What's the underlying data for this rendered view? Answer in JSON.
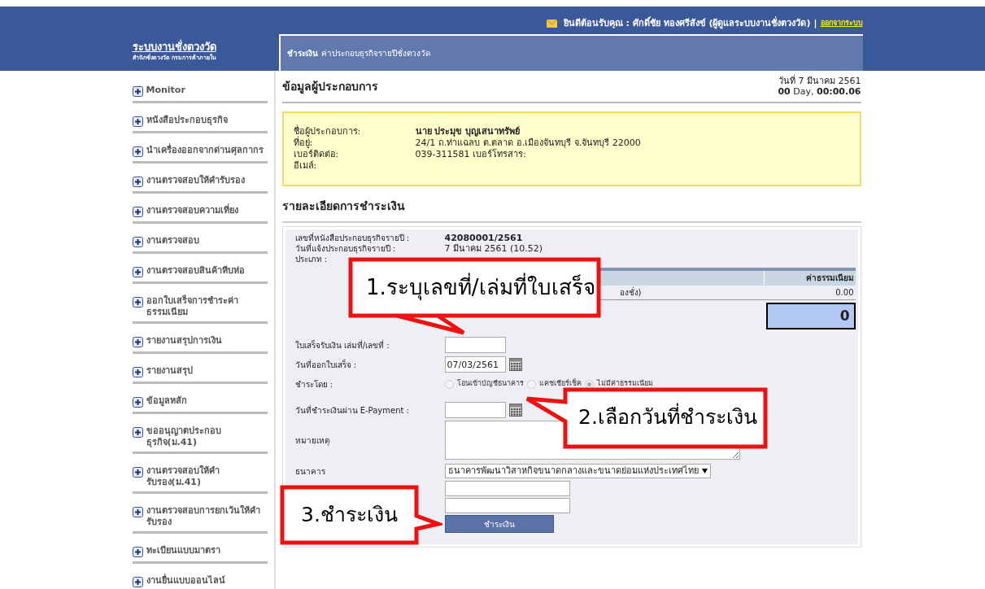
{
  "header": {
    "welcome": "ยินดีต้อนรับคุณ : ศักดิ์ชัย ทองศรีสังข์ (ผู้ดูแลระบบงานชั่งตวงวัด)",
    "separator": "|",
    "logout": "ออกจากระบบ"
  },
  "logo": {
    "title": "ระบบงานชั่งตวงวัด",
    "subtitle": "สำนักชั่งตวงวัด กรมการค้าภายใน"
  },
  "breadcrumb": {
    "section": "ชำระเงิน",
    "page": "ค่าประกอบธุรกิจรายปีชั่งตวงวัด"
  },
  "sidebar": {
    "items": [
      {
        "label": "Monitor"
      },
      {
        "label": "หนังสือประกอบธุรกิจ"
      },
      {
        "label": "นำเครื่องออกจากด่านศุลกากร"
      },
      {
        "label": "งานตรวจสอบให้คำรับรอง"
      },
      {
        "label": "งานตรวจสอบความเที่ยง"
      },
      {
        "label": "งานตรวจสอบ"
      },
      {
        "label": "งานตรวจสอบสินค้าหีบห่อ"
      },
      {
        "label": "ออกใบเสร็จการชำระค่าธรรมเนียม"
      },
      {
        "label": "รายงานสรุปการเงิน"
      },
      {
        "label": "รายงานสรุป"
      },
      {
        "label": "ข้อมูลหลัก"
      },
      {
        "label": "ขออนุญาตประกอบธุรกิจ(ม.41)"
      },
      {
        "label": "งานตรวจสอบให้คำรับรอง(ม.41)"
      },
      {
        "label": "งานตรวจสอบการยกเว้นให้คำรับรอง"
      },
      {
        "label": "ทะเบียนแบบมาตรา"
      },
      {
        "label": "งานยื่นแบบออนไลน์"
      }
    ]
  },
  "date": "วันที่ 7 มีนาคม 2561",
  "timer": "**00** Day, **00:00.06**",
  "operator": {
    "title": "ข้อมูลผู้ประกอบการ",
    "fields": [
      {
        "label": "ชื่อผู้ประกอบการ:",
        "value": "นาย ประมุข บุญเสนาทรัพย์",
        "bold": true
      },
      {
        "label": "ที่อยู่:",
        "value": "24/1 ถ.ท่าแฉลบ ต.ตลาด อ.เมืองจันทบุรี จ.จันทบุรี 22000",
        "bold": false
      },
      {
        "label": "เบอร์ติดต่อ:",
        "value": "039-311581 เบอร์โทรสาร:",
        "bold": false
      },
      {
        "label": "อีเมล์:"
      }
    ]
  },
  "payment": {
    "title": "รายละเอียดการชำระเงิน",
    "info": [
      {
        "label": "เลขที่หนังสือประกอบธุรกิจรายปี :",
        "value": "42080001/2561",
        "bold": true
      },
      {
        "label": "วันที่แจ้งประกอบธุรกิจรายปี :",
        "value": "7 มีนาคม 2561 (10.52)",
        "bold": false
      },
      {
        "label": "ประเภท :"
      }
    ],
    "fee_table": {
      "fee_column": "ค่าธรรมเนียม",
      "rows": [
        {
          "column_1": "องชั่ง)",
          "fee": "0.00"
        }
      ],
      "total": "0"
    },
    "receipt_no": {
      "label": "ใบเสร็จรับเงิน เล่มที่/เลขที่ :"
    },
    "issue_date": {
      "label": "วันที่ออกใบเสร็จ :",
      "value": "07/03/2561"
    },
    "pay_by": {
      "label": "ชำระโดย :",
      "options": [
        {
          "label": "โอนเข้าบัญชีธนาคาร",
          "selected": false
        },
        {
          "label": "แคชเชียร์เช็ค",
          "selected": false
        },
        {
          "label": "ไม่มีค่าธรรมเนียม",
          "selected": true
        }
      ]
    },
    "epayment_date": {
      "label": "วันที่ชำระเงินผ่าน E-Payment :"
    },
    "note": {
      "label": "หมายเหตุ"
    },
    "bank": {
      "label": "ธนาคาร",
      "value": "ธนาคารพัฒนาวิสาหกิจขนาดกลางและขนาดย่อมแห่งประเทศไทย"
    },
    "submit": "ชำระเงิน"
  },
  "callouts": [
    {
      "text": "1.ระบุเลขที่/เล่มที่ใบเสร็จ"
    },
    {
      "text": "2.เลือกวันที่ชำระเงิน"
    },
    {
      "text": "3.ชำระเงิน"
    }
  ]
}
